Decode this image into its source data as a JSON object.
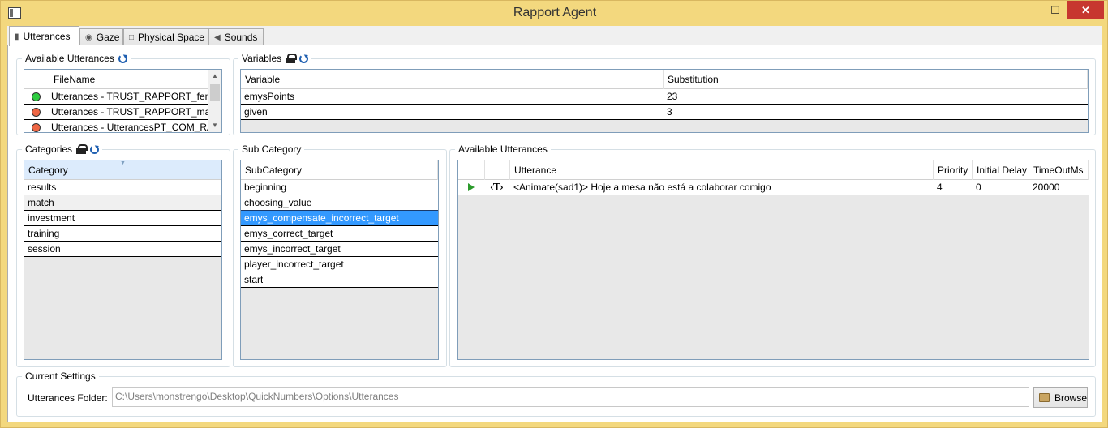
{
  "window": {
    "title": "Rapport Agent",
    "min": "–",
    "max": "☐",
    "close": "✕"
  },
  "tabs": [
    {
      "label": "Utterances",
      "icon": "utterances-icon"
    },
    {
      "label": "Gaze",
      "icon": "eye-icon"
    },
    {
      "label": "Physical Space",
      "icon": "square-icon"
    },
    {
      "label": "Sounds",
      "icon": "speaker-icon"
    }
  ],
  "available_utterances_files": {
    "title": "Available Utterances",
    "header": "FileName",
    "rows": [
      {
        "name": "Utterances - TRUST_RAPPORT_fem",
        "status": "#2ecc40"
      },
      {
        "name": "Utterances - TRUST_RAPPORT_mas",
        "status": "#ee6644"
      },
      {
        "name": "Utterances - UtterancesPT_COM_RAP",
        "status": "#ee6644"
      }
    ]
  },
  "variables": {
    "title": "Variables",
    "headers": [
      "Variable",
      "Substitution"
    ],
    "rows": [
      [
        "emysPoints",
        "23"
      ],
      [
        "given",
        "3"
      ]
    ]
  },
  "categories": {
    "title": "Categories",
    "header": "Category",
    "rows": [
      "results",
      "match",
      "investment",
      "training",
      "session"
    ]
  },
  "subcategory": {
    "title": "Sub Category",
    "header": "SubCategory",
    "rows": [
      "beginning",
      "choosing_value",
      "emys_compensate_incorrect_target",
      "emys_correct_target",
      "emys_incorrect_target",
      "player_incorrect_target",
      "start"
    ],
    "selected_index": 2
  },
  "utterances_list": {
    "title": "Available Utterances",
    "headers": [
      "Utterance",
      "Priority",
      "Initial Delay",
      "TimeOutMs"
    ],
    "rows": [
      {
        "utterance": "<Animate(sad1)> Hoje a mesa não está a colaborar comigo",
        "priority": "4",
        "delay": "0",
        "timeout": "20000"
      }
    ],
    "t_glyph": "‹T›"
  },
  "settings": {
    "title": "Current Settings",
    "folder_label": "Utterances Folder:",
    "folder_value": "C:\\Users\\monstrengo\\Desktop\\QuickNumbers\\Options\\Utterances",
    "browse_label": "Browse"
  }
}
